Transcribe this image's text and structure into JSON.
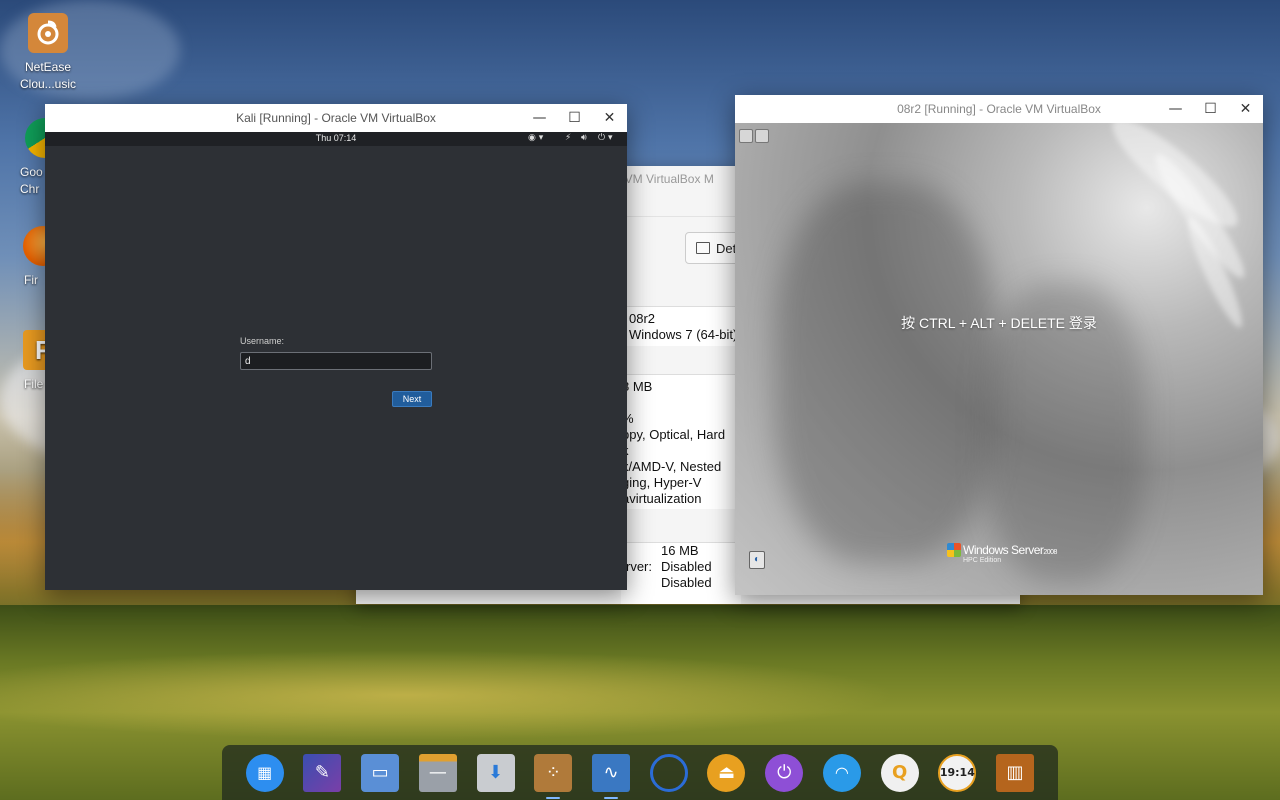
{
  "desktop": {
    "icons": [
      {
        "label": "NetEase Clou...usic",
        "icon": "netease-music-icon",
        "color": "#d4873a"
      },
      {
        "label": "Goo Chr",
        "icon": "chrome-icon",
        "color": "#3b8f3e"
      },
      {
        "label": "Fir",
        "icon": "firefox-icon",
        "color": "#e66000"
      },
      {
        "label": "File",
        "icon": "file-manager-icon",
        "color": "#e89a20"
      }
    ]
  },
  "manager_window": {
    "title_partial": "cle VM VirtualBox M",
    "details_button": "Det",
    "vm_name": "08r2",
    "vm_os": "Windows 7 (64-bit)",
    "memory_partial": "8 MB",
    "percent_partial": "%",
    "boot_order_partial": [
      "ppy, Optical, Hard",
      "k"
    ],
    "accel_partial": [
      "x/AMD-V, Nested",
      "ging, Hyper-V",
      "avirtualization"
    ],
    "display_label_partial": "rver:",
    "display_values": [
      "16 MB",
      "Disabled",
      "Disabled"
    ]
  },
  "kali_window": {
    "title": "Kali [Running] - Oracle VM VirtualBox",
    "clock": "Thu 07:14",
    "username_label": "Username:",
    "username_value": "d",
    "next_button": "Next"
  },
  "win08_window": {
    "title": "08r2 [Running] - Oracle VM VirtualBox",
    "login_prompt": "按 CTRL + ALT + DELETE 登录",
    "logo_name": "Windows Server",
    "logo_year": "2008",
    "logo_edition": "HPC Edition"
  },
  "window_controls": {
    "minimize": "—",
    "maximize": "☐",
    "close": "✕"
  },
  "dock": {
    "items": [
      {
        "name": "launcher",
        "color": "#2d8ef0"
      },
      {
        "name": "screenshot",
        "color": "#5b4aa8"
      },
      {
        "name": "multitasking",
        "color": "#5a8fd6"
      },
      {
        "name": "file-manager",
        "color": "#8a8f96"
      },
      {
        "name": "app-store",
        "color": "#c9ccd0"
      },
      {
        "name": "virtualbox",
        "color": "#b07a3a"
      },
      {
        "name": "system-monitor",
        "color": "#3a78c2"
      },
      {
        "name": "browser",
        "color": "#2b6cd6"
      },
      {
        "name": "disk-eject",
        "color": "#e8a020"
      },
      {
        "name": "power",
        "color": "#8e4fd6"
      },
      {
        "name": "wifi",
        "color": "#2a9ae8"
      },
      {
        "name": "qq",
        "color": "#f0f0f0"
      },
      {
        "name": "clock",
        "color": "#f2f2f2",
        "text": "19:14"
      },
      {
        "name": "trash",
        "color": "#b5651d"
      }
    ]
  }
}
